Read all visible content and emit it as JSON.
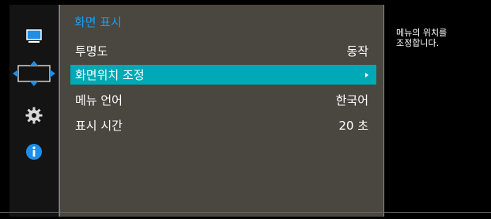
{
  "panel": {
    "title": "화면 표시",
    "accent_color": "#1a9ef0",
    "selected_color": "#00a9b5",
    "items": [
      {
        "label": "투명도",
        "value": "동작"
      },
      {
        "label": "화면위치 조정",
        "value": "",
        "selected": true,
        "has_submenu_arrow": true
      },
      {
        "label": "메뉴 언어",
        "value": "한국어"
      },
      {
        "label": "표시 시간",
        "value": "20 초"
      }
    ]
  },
  "sidebar": {
    "icons": [
      "monitor-icon",
      "position-adjust-icon",
      "gear-icon",
      "info-icon"
    ],
    "active_icon": "position-adjust-icon"
  },
  "help": {
    "line1": "메뉴의 위치를",
    "line2": "조정합니다."
  }
}
